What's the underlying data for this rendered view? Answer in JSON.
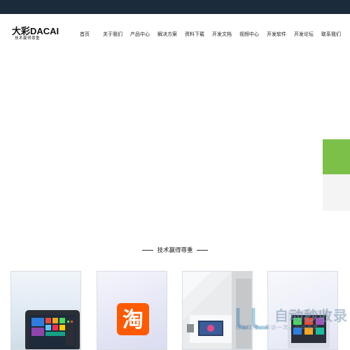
{
  "header": {
    "logo_text": "大彩DACAI",
    "logo_tagline": "技术赢得尊重"
  },
  "nav": {
    "items": [
      {
        "label": "首页"
      },
      {
        "label": "关于我们"
      },
      {
        "label": "产品中心"
      },
      {
        "label": "解决方案"
      },
      {
        "label": "资料下载"
      },
      {
        "label": "开发文档"
      },
      {
        "label": "视频中心"
      },
      {
        "label": "开发软件"
      },
      {
        "label": "开发论坛"
      },
      {
        "label": "联系我们"
      }
    ]
  },
  "section": {
    "title": "技术赢得尊重"
  },
  "cards": [
    {
      "icon": "touch-screen-display-image"
    },
    {
      "icon": "taobao-icon",
      "glyph": "淘"
    },
    {
      "icon": "wall-mounted-display-image"
    },
    {
      "icon": "control-panel-image"
    }
  ],
  "watermark": {
    "text": "自动秒收录",
    "subtext": "线上链接，来访一次，自动收录"
  },
  "colors": {
    "topbar": "#1b2b3c",
    "side_accent": "#7cc04a",
    "taobao": "#ff5a00"
  }
}
